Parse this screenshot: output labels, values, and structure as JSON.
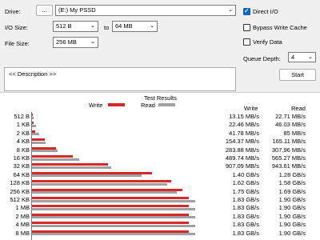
{
  "form": {
    "drive_label": "Drive:",
    "browse_label": "...",
    "drive_value": "(E:) My PSSD",
    "io_size_label": "I/O Size:",
    "io_from": "512 B",
    "io_to_label": "to",
    "io_to": "64 MB",
    "file_size_label": "File Size:",
    "file_size": "256 MB",
    "direct_io_label": "Direct I/O",
    "direct_io_checked": true,
    "bypass_cache_label": "Bypass Write Cache",
    "bypass_cache_checked": false,
    "verify_label": "Verify Data",
    "verify_checked": false,
    "queue_depth_label": "Queue Depth:",
    "queue_depth": "4",
    "description_text": "<< Description >>",
    "start_label": "Start"
  },
  "results": {
    "title": "Test Results",
    "write_legend": "Write",
    "read_legend": "Read",
    "write_header": "Write",
    "read_header": "Read",
    "colors": {
      "write": "#d62828",
      "read": "#a0a0a0"
    }
  },
  "chart_data": {
    "type": "bar",
    "title": "Test Results",
    "categories": [
      "512 B",
      "1 KB",
      "2 KB",
      "4 KB",
      "8 KB",
      "16 KB",
      "32 KB",
      "64 KB",
      "128 KB",
      "256 KB",
      "512 KB",
      "1 MB",
      "2 MB",
      "4 MB",
      "8 MB"
    ],
    "series": [
      {
        "name": "Write",
        "labels": [
          "13.15 MB/s",
          "22.46 MB/s",
          "41.78 MB/s",
          "154.37 MB/s",
          "283.88 MB/s",
          "489.74 MB/s",
          "907.09 MB/s",
          "1.40 GB/s",
          "1.62 GB/s",
          "1.75 GB/s",
          "1.83 GB/s",
          "1.83 GB/s",
          "1.83 GB/s",
          "1.83 GB/s",
          "1.83 GB/s"
        ],
        "values_mbps": [
          13.15,
          22.46,
          41.78,
          154.37,
          283.88,
          489.74,
          907.09,
          1433.6,
          1658.9,
          1792,
          1873.9,
          1873.9,
          1873.9,
          1873.9,
          1873.9
        ]
      },
      {
        "name": "Read",
        "labels": [
          "22.71 MB/s",
          "46.03 MB/s",
          "85 MB/s",
          "165.11 MB/s",
          "307.96 MB/s",
          "565.27 MB/s",
          "943.61 MB/s",
          "1.28 GB/s",
          "1.58 GB/s",
          "1.69 GB/s",
          "1.90 GB/s",
          "1.90 GB/s",
          "1.90 GB/s",
          "1.90 GB/s",
          "1.90 GB/s"
        ],
        "values_mbps": [
          22.71,
          46.03,
          85,
          165.11,
          307.96,
          565.27,
          943.61,
          1310.7,
          1617.9,
          1730.6,
          1945.6,
          1945.6,
          1945.6,
          1945.6,
          1945.6
        ]
      }
    ],
    "xmax_mbps": 2100,
    "legend": "top-center"
  }
}
